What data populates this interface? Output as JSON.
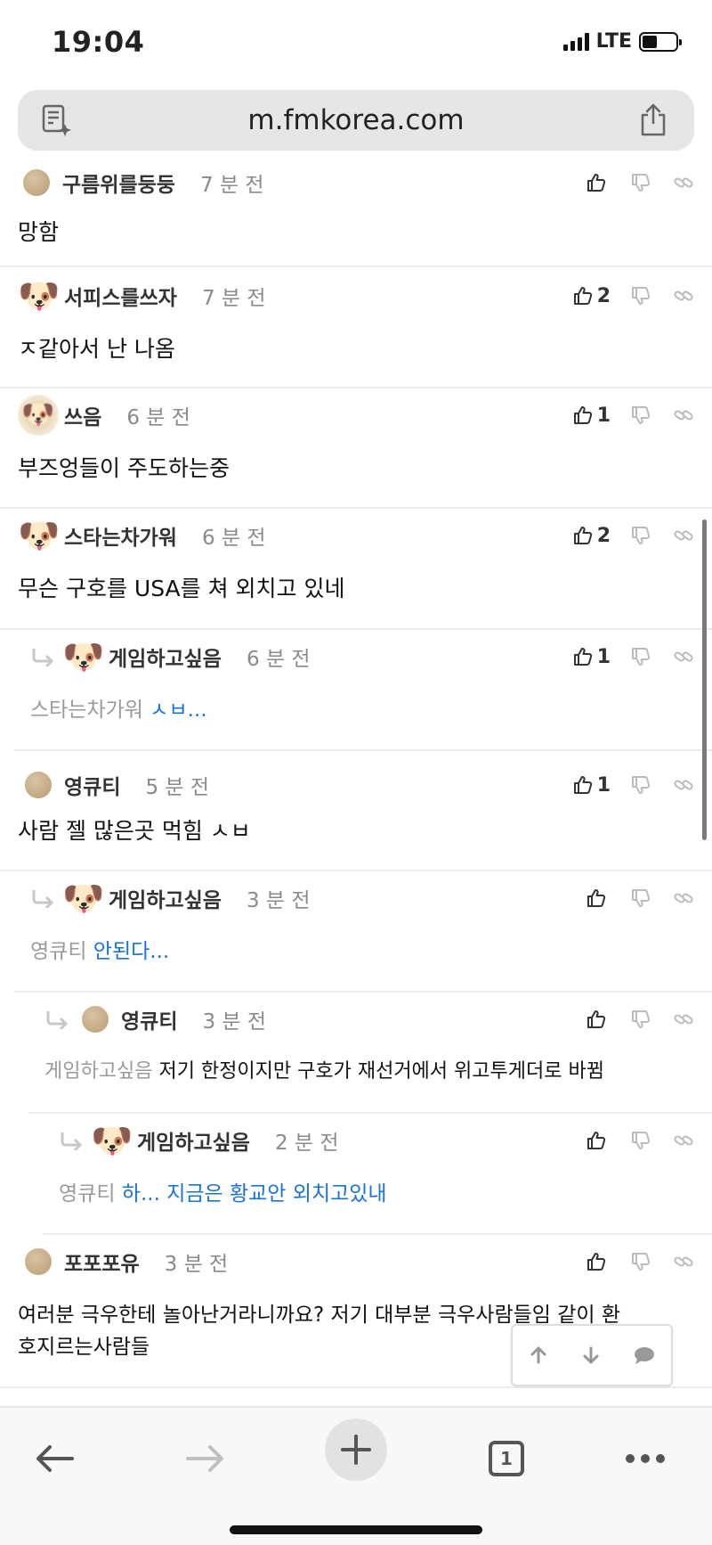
{
  "status": {
    "time": "19:04",
    "network": "LTE"
  },
  "browser": {
    "url": "m.fmkorea.com",
    "tab_count": "1"
  },
  "comments": [
    {
      "nick": "구름위를둥둥",
      "time": "7 분 전",
      "text": "망함",
      "likes": ""
    },
    {
      "nick": "서피스를쓰자",
      "time": "7 분 전",
      "text": "ㅈ같아서 난 나옴",
      "likes": "2"
    },
    {
      "nick": "쓰음",
      "time": "6 분 전",
      "text": "부즈엉들이 주도하는중",
      "likes": "1"
    },
    {
      "nick": "스타는차가워",
      "time": "6 분 전",
      "text": "무슨 구호를 USA를 쳐 외치고 있네",
      "likes": "2"
    },
    {
      "nick": "게임하고싶음",
      "time": "6 분 전",
      "ref": "스타는차가워",
      "text": "ㅅㅂ...",
      "likes": "1"
    },
    {
      "nick": "영큐티",
      "time": "5 분 전",
      "text": "사람 젤 많은곳 먹힘 ㅅㅂ",
      "likes": "1"
    },
    {
      "nick": "게임하고싶음",
      "time": "3 분 전",
      "ref": "영큐티",
      "text": "안된다...",
      "likes": ""
    },
    {
      "nick": "영큐티",
      "time": "3 분 전",
      "ref": "게임하고싶음",
      "text": "저기 한정이지만 구호가 재선거에서 위고투게더로 바뀜",
      "likes": ""
    },
    {
      "nick": "게임하고싶음",
      "time": "2 분 전",
      "ref": "영큐티",
      "text": "하... 지금은 황교안 외치고있내",
      "likes": ""
    },
    {
      "nick": "포포포유",
      "time": "3 분 전",
      "text_line1": "여러분 극우한테 놀아난거라니까요? 저기 대부분 극우사람들임 같이 환",
      "text_line2": "호지르는사람들",
      "likes": ""
    }
  ],
  "icons": [
    "thumbs-up-icon",
    "thumbs-down-icon",
    "link-icon",
    "reply-arrow-icon",
    "reader-icon",
    "share-icon",
    "back-icon",
    "forward-icon",
    "plus-icon",
    "tabs-icon",
    "more-icon",
    "up-arrow-icon",
    "down-arrow-icon",
    "comment-icon"
  ]
}
